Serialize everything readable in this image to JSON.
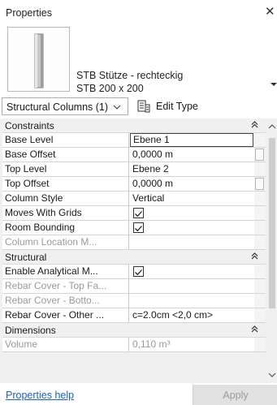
{
  "panel": {
    "title": "Properties",
    "close_glyph": "✕"
  },
  "type_selector": {
    "name": "STB Stütze - rechteckig",
    "size": "STB 200 x 200"
  },
  "instance_selector": {
    "value": "Structural Columns (1)"
  },
  "edit_type": {
    "label": "Edit Type"
  },
  "groups": [
    {
      "label": "Constraints",
      "rows": [
        {
          "name": "Base Level",
          "value": "Ebene 1",
          "active": true
        },
        {
          "name": "Base Offset",
          "value": "0,0000 m"
        },
        {
          "name": "Top Level",
          "value": "Ebene 2"
        },
        {
          "name": "Top Offset",
          "value": "0,0000 m"
        },
        {
          "name": "Column Style",
          "value": "Vertical"
        },
        {
          "name": "Moves With Grids",
          "checked": true
        },
        {
          "name": "Room Bounding",
          "checked": true
        },
        {
          "name": "Column Location M...",
          "value": "",
          "disabled": true
        }
      ]
    },
    {
      "label": "Structural",
      "rows": [
        {
          "name": "Enable Analytical M...",
          "checked": true
        },
        {
          "name": "Rebar Cover - Top Fa...",
          "value": "",
          "disabled": true
        },
        {
          "name": "Rebar Cover - Botto...",
          "value": "",
          "disabled": true
        },
        {
          "name": "Rebar Cover - Other ...",
          "value": "c=2.0cm <2,0 cm>"
        }
      ]
    },
    {
      "label": "Dimensions",
      "rows": [
        {
          "name": "Volume",
          "value": "0,110 m³",
          "disabled": true
        }
      ]
    }
  ],
  "footer": {
    "help_label": "Properties help",
    "apply_label": "Apply"
  },
  "colors": {
    "link": "#1565c0",
    "group_bg": "#f0f0f0",
    "disabled_text": "#9a9a9a"
  },
  "icons": {
    "close": "close-icon",
    "type_preview": "column-preview-icon",
    "dropdown": "chevron-down-icon",
    "edit_type": "edit-type-icon",
    "collapse": "collapse-icon",
    "checkbox": "checkmark-icon"
  }
}
